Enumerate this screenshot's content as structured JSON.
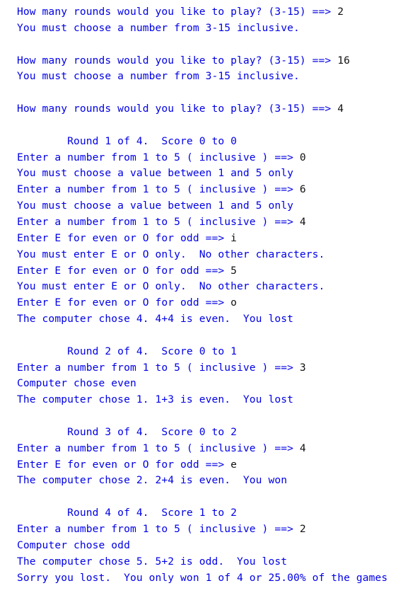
{
  "console": {
    "colors": {
      "output": "#0000e6",
      "user_input": "#111111",
      "background": "#ffffff"
    },
    "lines": [
      {
        "type": "prompt",
        "text": "How many rounds would you like to play? (3-15) ==> ",
        "input": "2"
      },
      {
        "type": "output",
        "text": "You must choose a number from 3-15 inclusive."
      },
      {
        "type": "blank",
        "text": ""
      },
      {
        "type": "prompt",
        "text": "How many rounds would you like to play? (3-15) ==> ",
        "input": "16"
      },
      {
        "type": "output",
        "text": "You must choose a number from 3-15 inclusive."
      },
      {
        "type": "blank",
        "text": ""
      },
      {
        "type": "prompt",
        "text": "How many rounds would you like to play? (3-15) ==> ",
        "input": "4"
      },
      {
        "type": "blank",
        "text": ""
      },
      {
        "type": "header",
        "text": "        Round 1 of 4.  Score 0 to 0"
      },
      {
        "type": "prompt",
        "text": "Enter a number from 1 to 5 ( inclusive ) ==> ",
        "input": "0"
      },
      {
        "type": "output",
        "text": "You must choose a value between 1 and 5 only"
      },
      {
        "type": "prompt",
        "text": "Enter a number from 1 to 5 ( inclusive ) ==> ",
        "input": "6"
      },
      {
        "type": "output",
        "text": "You must choose a value between 1 and 5 only"
      },
      {
        "type": "prompt",
        "text": "Enter a number from 1 to 5 ( inclusive ) ==> ",
        "input": "4"
      },
      {
        "type": "prompt",
        "text": "Enter E for even or O for odd ==> ",
        "input": "i"
      },
      {
        "type": "output",
        "text": "You must enter E or O only.  No other characters."
      },
      {
        "type": "prompt",
        "text": "Enter E for even or O for odd ==> ",
        "input": "5"
      },
      {
        "type": "output",
        "text": "You must enter E or O only.  No other characters."
      },
      {
        "type": "prompt",
        "text": "Enter E for even or O for odd ==> ",
        "input": "o"
      },
      {
        "type": "output",
        "text": "The computer chose 4. 4+4 is even.  You lost"
      },
      {
        "type": "blank",
        "text": ""
      },
      {
        "type": "header",
        "text": "        Round 2 of 4.  Score 0 to 1"
      },
      {
        "type": "prompt",
        "text": "Enter a number from 1 to 5 ( inclusive ) ==> ",
        "input": "3"
      },
      {
        "type": "output",
        "text": "Computer chose even"
      },
      {
        "type": "output",
        "text": "The computer chose 1. 1+3 is even.  You lost"
      },
      {
        "type": "blank",
        "text": ""
      },
      {
        "type": "header",
        "text": "        Round 3 of 4.  Score 0 to 2"
      },
      {
        "type": "prompt",
        "text": "Enter a number from 1 to 5 ( inclusive ) ==> ",
        "input": "4"
      },
      {
        "type": "prompt",
        "text": "Enter E for even or O for odd ==> ",
        "input": "e"
      },
      {
        "type": "output",
        "text": "The computer chose 2. 2+4 is even.  You won"
      },
      {
        "type": "blank",
        "text": ""
      },
      {
        "type": "header",
        "text": "        Round 4 of 4.  Score 1 to 2"
      },
      {
        "type": "prompt",
        "text": "Enter a number from 1 to 5 ( inclusive ) ==> ",
        "input": "2"
      },
      {
        "type": "output",
        "text": "Computer chose odd"
      },
      {
        "type": "output",
        "text": "The computer chose 5. 5+2 is odd.  You lost"
      },
      {
        "type": "output",
        "text": "Sorry you lost.  You only won 1 of 4 or 25.00% of the games"
      }
    ]
  }
}
